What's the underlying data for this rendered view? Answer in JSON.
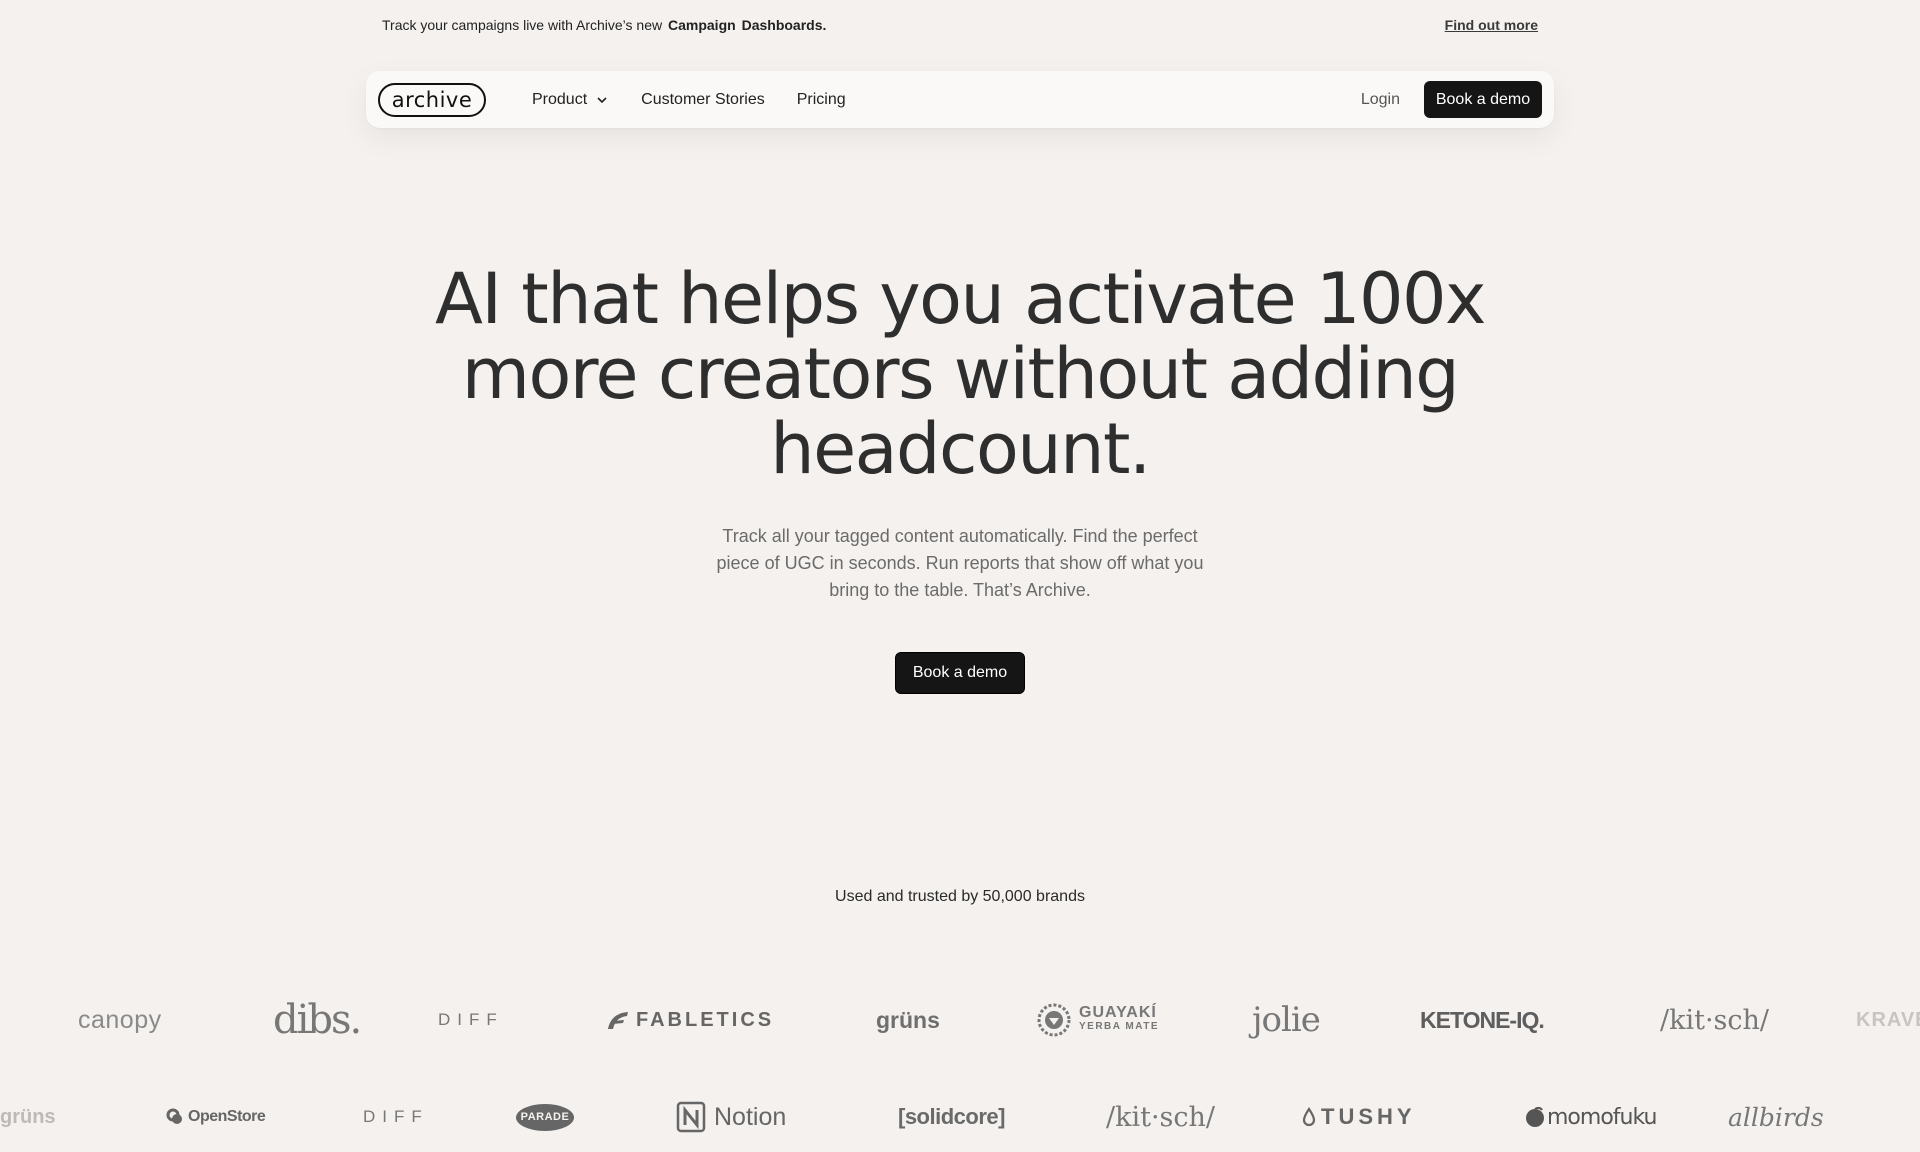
{
  "announcement": {
    "text": "Track your campaigns live with Archive’s new",
    "bold1": "Campaign",
    "bold2": "Dashboards.",
    "link": "Find out more"
  },
  "nav": {
    "logo": "archive",
    "items": [
      {
        "label": "Product",
        "icon": "chevron-down-icon"
      },
      {
        "label": "Customer Stories"
      },
      {
        "label": "Pricing"
      }
    ],
    "login": "Login",
    "cta": "Book a demo"
  },
  "hero": {
    "title_line1": "AI that helps you activate 100x",
    "title_line2": "more creators without adding",
    "title_line3": "headcount.",
    "subtitle": "Track all your tagged content automatically. Find the perfect piece of UGC in seconds. Run reports that show off what you bring to the table. That’s Archive.",
    "cta": "Book a demo"
  },
  "trusted": "Used and trusted by 50,000 brands",
  "logos_row1": [
    "canopy",
    "dibs.",
    "DIFF",
    "FABLETICS",
    "grüns",
    "GUAYAKÍ",
    "YERBA MATE",
    "jolie",
    "KETONE-IQ.",
    "/kit·sch/",
    "KRAVE"
  ],
  "logos_row2": [
    "grüns",
    "OpenStore",
    "DIFF",
    "PARADE",
    "Notion",
    "[solidcore]",
    "/kit·sch/",
    "TUSHY",
    "momofuku",
    "allbirds"
  ],
  "colors": {
    "background": "#f4f1ee",
    "button": "#151515",
    "nav_bg": "#faf9f7"
  }
}
